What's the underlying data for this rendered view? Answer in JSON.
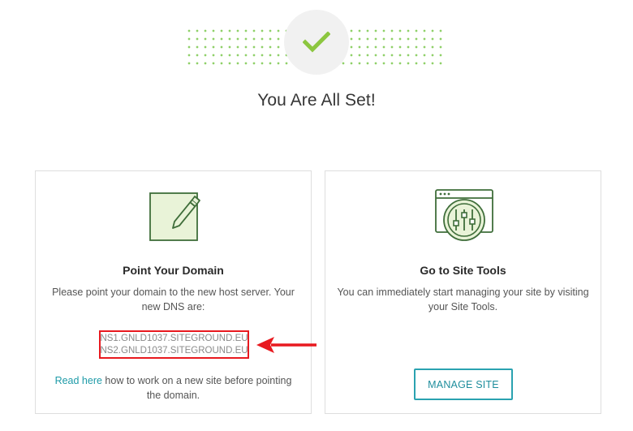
{
  "header": {
    "title": "You Are All Set!",
    "success_icon": "checkmark-icon",
    "accent_color": "#8cc63f"
  },
  "cards": {
    "domain": {
      "icon": "edit-note-icon",
      "title": "Point Your Domain",
      "description": "Please point your domain to the new host server. Your new DNS are:",
      "dns": [
        "NS1.GNLD1037.SITEGROUND.EU",
        "NS2.GNLD1037.SITEGROUND.EU"
      ],
      "read_here_link": "Read here",
      "note_rest": " how to work on a new site before pointing the domain."
    },
    "tools": {
      "icon": "site-tools-icon",
      "title": "Go to Site Tools",
      "description": "You can immediately start managing your site by visiting your Site Tools.",
      "button_label": "MANAGE SITE"
    }
  },
  "annotation": {
    "highlight_color": "#e8191f",
    "arrow_icon": "red-arrow-left-icon"
  }
}
